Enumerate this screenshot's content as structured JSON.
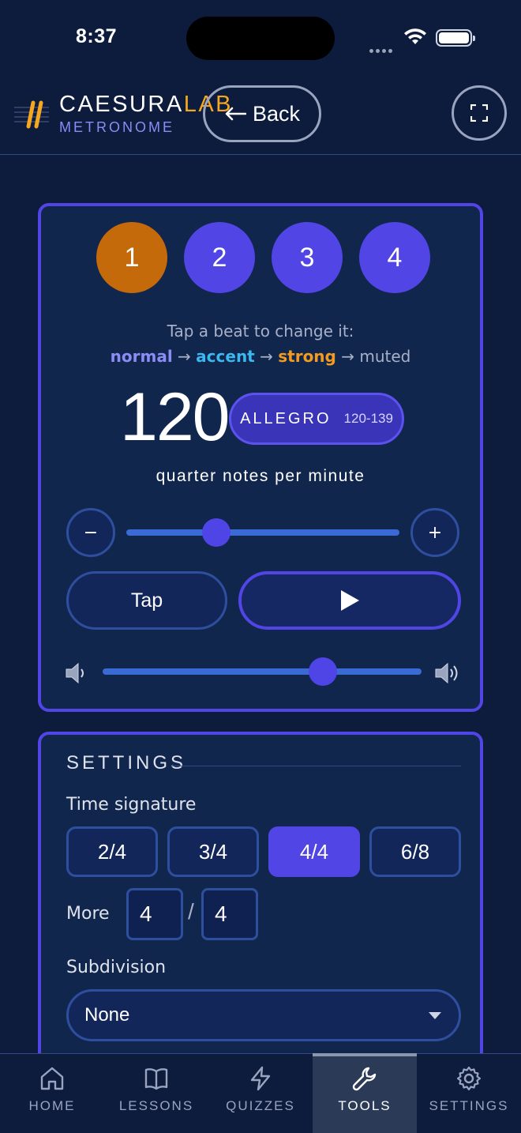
{
  "status_bar": {
    "time": "8:37"
  },
  "header": {
    "brand_name_primary": "CAESURA",
    "brand_name_accent": "LAB",
    "brand_sub": "METRONOME",
    "back_label": "Back",
    "fullscreen_icon": "fullscreen-icon"
  },
  "metronome": {
    "beats": [
      {
        "label": "1",
        "state": "strong"
      },
      {
        "label": "2",
        "state": "normal"
      },
      {
        "label": "3",
        "state": "normal"
      },
      {
        "label": "4",
        "state": "normal"
      }
    ],
    "hint": "Tap a beat to change it:",
    "legend": {
      "normal": "normal",
      "accent": "accent",
      "strong": "strong",
      "muted": "muted",
      "arrow": "→"
    },
    "bpm": "120",
    "tempo_name": "ALLEGRO",
    "tempo_range": "120-139",
    "bpm_unit": "quarter notes per minute",
    "decrement_label": "−",
    "increment_label": "+",
    "tempo_slider_fraction": 0.33,
    "tap_label": "Tap",
    "volume_fraction": 0.69
  },
  "settings": {
    "title": "SETTINGS",
    "time_signature_label": "Time signature",
    "time_signatures": [
      "2/4",
      "3/4",
      "4/4",
      "6/8"
    ],
    "time_signature_selected": "4/4",
    "more_label": "More",
    "more_numerator": "4",
    "more_denominator": "4",
    "more_slash": "/",
    "subdivision_label": "Subdivision",
    "subdivision_value": "None"
  },
  "nav": {
    "items": [
      {
        "label": "HOME",
        "icon": "home-icon"
      },
      {
        "label": "LESSONS",
        "icon": "book-icon"
      },
      {
        "label": "QUIZZES",
        "icon": "lightning-icon"
      },
      {
        "label": "TOOLS",
        "icon": "wrench-icon"
      },
      {
        "label": "SETTINGS",
        "icon": "gear-icon"
      }
    ],
    "active": "TOOLS"
  },
  "colors": {
    "background": "#0d1b3d",
    "card": "#11264d",
    "accent_purple": "#5145e6",
    "strong_orange": "#c56a0a",
    "brand_gold": "#f4a720"
  }
}
